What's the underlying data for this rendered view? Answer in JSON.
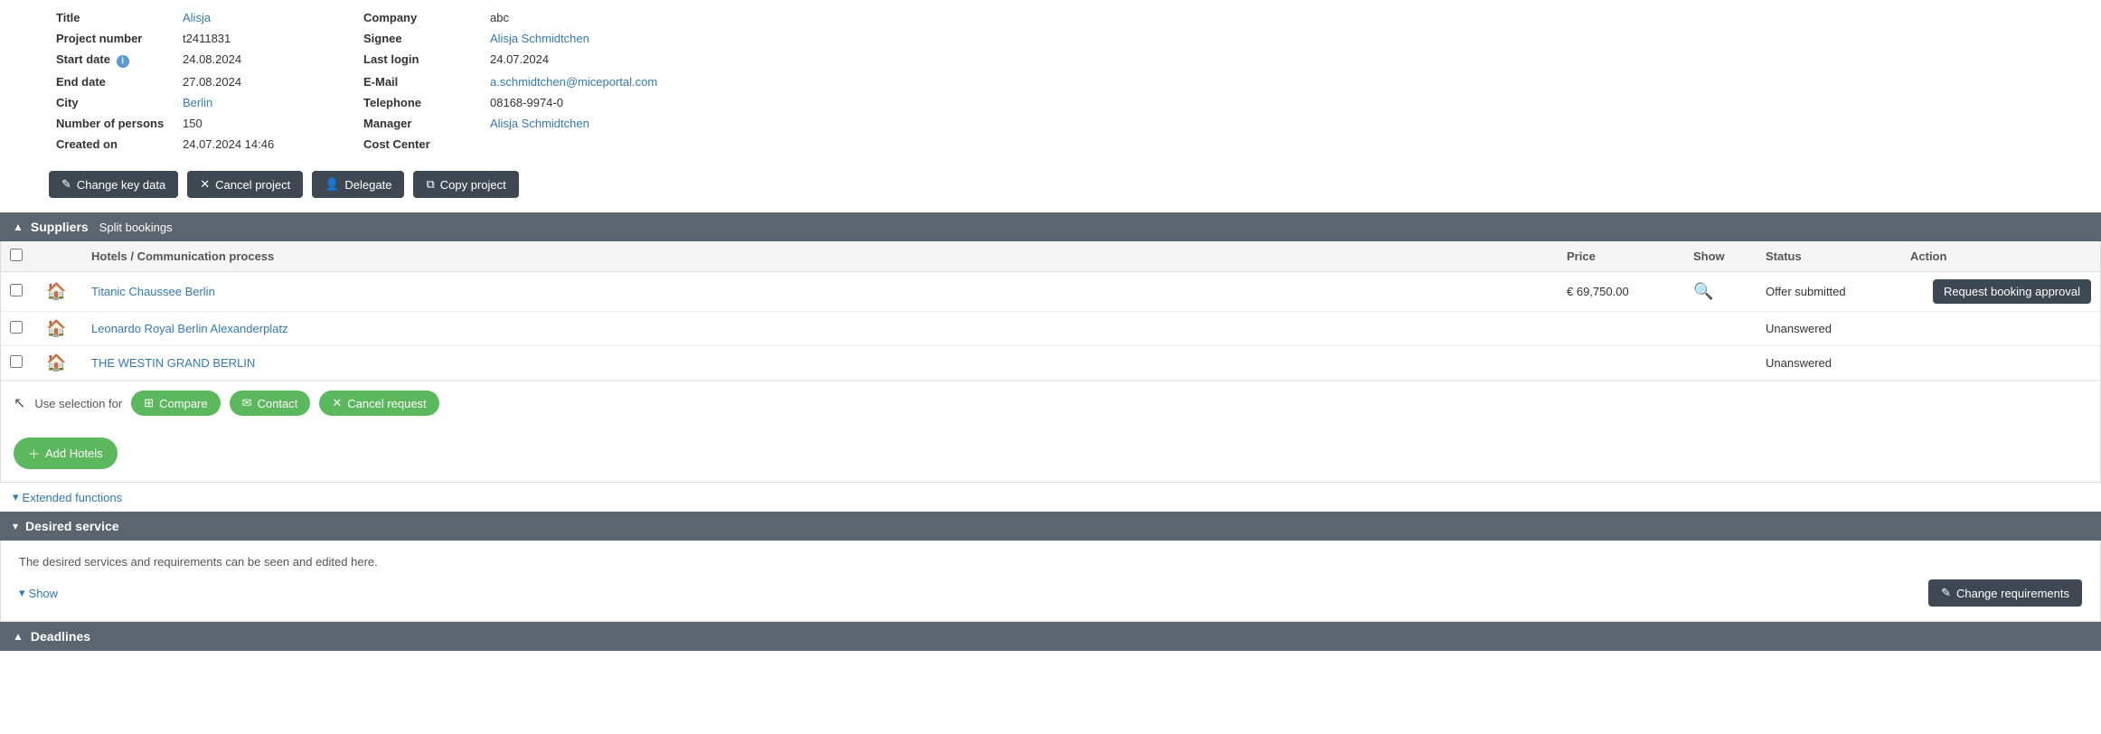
{
  "keyData": {
    "row1": {
      "label1": "Title",
      "value1": "Alisja",
      "label2": "Company",
      "value2": "abc"
    },
    "row2": {
      "label1": "Project number",
      "value1": "t2411831",
      "label2": "Signee",
      "value2": "Alisja Schmidtchen"
    },
    "row3": {
      "label1": "Start date",
      "value1": "24.08.2024",
      "label2": "Last login",
      "value2": "24.07.2024"
    },
    "row4": {
      "label1": "End date",
      "value1": "27.08.2024",
      "label2": "E-Mail",
      "value2": "a.schmidtchen@miceportal.com"
    },
    "row5": {
      "label1": "City",
      "value1": "Berlin",
      "label2": "Telephone",
      "value2": "08168-9974-0"
    },
    "row6": {
      "label1": "Number of persons",
      "value1": "150",
      "label2": "Manager",
      "value2": "Alisja Schmidtchen"
    },
    "row7": {
      "label1": "Created on",
      "value1": "24.07.2024 14:46",
      "label2": "Cost Center",
      "value2": ""
    }
  },
  "actionButtons": {
    "changeKeyData": "Change key data",
    "cancelProject": "Cancel project",
    "delegate": "Delegate",
    "copyProject": "Copy project"
  },
  "suppliersSection": {
    "title": "Suppliers",
    "subtitle": "Split bookings",
    "chevron": "▲",
    "tableHeaders": {
      "checkbox": "",
      "icon": "",
      "hotel": "Hotels / Communication process",
      "price": "Price",
      "show": "Show",
      "status": "Status",
      "action": "Action"
    },
    "hotels": [
      {
        "id": 1,
        "name": "Titanic Chaussee Berlin",
        "price": "€ 69,750.00",
        "hasShow": true,
        "status": "Offer submitted",
        "action": "Request booking approval"
      },
      {
        "id": 2,
        "name": "Leonardo Royal Berlin Alexanderplatz",
        "price": "",
        "hasShow": false,
        "status": "Unanswered",
        "action": ""
      },
      {
        "id": 3,
        "name": "THE WESTIN GRAND BERLIN",
        "price": "",
        "hasShow": false,
        "status": "Unanswered",
        "action": ""
      }
    ],
    "selectionBar": {
      "label": "Use selection for",
      "arrowIcon": "↖",
      "compareBtn": "Compare",
      "contactBtn": "Contact",
      "cancelRequestBtn": "Cancel request"
    },
    "addHotelsBtn": "Add Hotels"
  },
  "extendedFunctions": {
    "chevron": "▾",
    "label": "Extended functions"
  },
  "desiredService": {
    "sectionTitle": "Desired service",
    "chevron": "▾",
    "note": "The desired services and requirements can be seen and edited here.",
    "showLabel": "Show",
    "changeRequirementsBtn": "Change requirements"
  },
  "deadlines": {
    "sectionTitle": "Deadlines",
    "chevron": "▲"
  }
}
